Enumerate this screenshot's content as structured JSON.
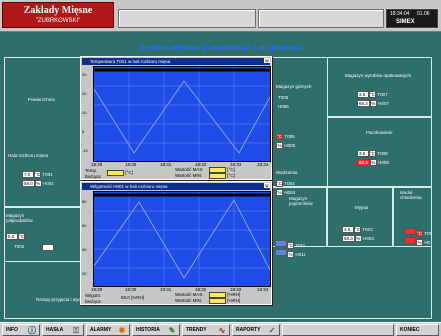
{
  "header": {
    "brand_title": "Zakłady Mięsne",
    "brand_subtitle": "\"ZUBRKOWSKI\"",
    "clock_time": "18:34:04",
    "clock_date": "01.06",
    "clock_brand": "SIMEX"
  },
  "main": {
    "title": "System rejestracji temperatur i wilgotności",
    "zones": {
      "z_gorny": {
        "label": "Magazyn górnych",
        "t_id": "T006",
        "h_id": "H006"
      },
      "z_opakowan": {
        "label": "Magazyn wyrobów opakowanych",
        "t_val": "3.5",
        "t_id": "T007",
        "h_val": "68.3",
        "h_id": "H007"
      },
      "z_peklowania": {
        "label": "Peklownia",
        "t_id": "T005",
        "h_id": "H005"
      },
      "z_pacz": {
        "label": "Paczkowanie",
        "t_val": "3.5",
        "t_id": "T008",
        "h_val": "68.3",
        "h_id": "H008"
      },
      "z_rozbior": {
        "label": "Hala rozbioru mięsa",
        "t_val": "7.0",
        "t_id": "T001",
        "h_val": "58.0",
        "h_id": "H001"
      },
      "z_wedz": {
        "label": "Wędzarnia",
        "t_id": "T004",
        "h_id": "H004"
      },
      "z_mag_polprod": {
        "label": "Magazyn półproduktów",
        "t_val": "5.0",
        "t_id": "T002",
        "h_val": "",
        "h_id": "H002"
      },
      "z_myjnia": {
        "label": "Myjnia",
        "t_val": "3.5",
        "t_id": "T003",
        "h_val": "68.3",
        "h_id": "H003"
      },
      "z_mag_pojemn": {
        "label": "Magazyn pojemników",
        "t_val": "",
        "t_id": "T011",
        "h_val": "",
        "h_id": "H011"
      },
      "z_modul": {
        "label": "Moduł chłodzenia",
        "t_val": "",
        "t_id": "T00",
        "h_val": "",
        "h_id": "H0"
      },
      "z_pol": {
        "label": "Powierzchnia",
        "t_id": "",
        "h_id": ""
      },
      "z_rampa": {
        "label": "Rampy przyjęcia i wydania",
        "t_id": "",
        "h_id": ""
      }
    },
    "unit_c": "°C",
    "unit_h": "%"
  },
  "popup_temp": {
    "title": "Temperatura T001 w hali rozbioru mięsa",
    "x_ticks": [
      "18:29",
      "18:30",
      "18:31",
      "18:32",
      "18:33",
      "18:34"
    ],
    "y_ticks": [
      "30",
      "20",
      "10",
      "0",
      "-10"
    ],
    "current_label": "Temp. bieżąca:",
    "current_unit": "[°C]",
    "max_label": "Wartość MAX:",
    "min_label": "Wartość MIN:",
    "unit_label": "[°C]"
  },
  "popup_hum": {
    "title": "Wilgotność H001 w hali rozbioru mięsa",
    "x_ticks": [
      "18:29",
      "18:30",
      "18:31",
      "18:32",
      "18:33",
      "18:34"
    ],
    "y_ticks": [
      "80",
      "60",
      "40",
      "20"
    ],
    "current_label": "Wilgotn. bieżąca:",
    "current_value": "58.0",
    "current_unit": "[%RH]",
    "max_label": "Wartość MAX:",
    "min_label": "Wartość MIN:",
    "unit_label": "[%RH]"
  },
  "footer": {
    "info": "INFO",
    "hasla": "HASŁA",
    "alarmy": "ALARMY",
    "historia": "HISTORIA",
    "trendy": "TRENDY",
    "raporty": "RAPORTY",
    "koniec": "KONIEC"
  },
  "colors": {
    "background": "#2e6f6b",
    "brand": "#b01818",
    "title": "#2a6ff0",
    "plot": "#1f4ce6",
    "titlebar": "#0a2f8e",
    "alarm": "#ff2b2b"
  }
}
